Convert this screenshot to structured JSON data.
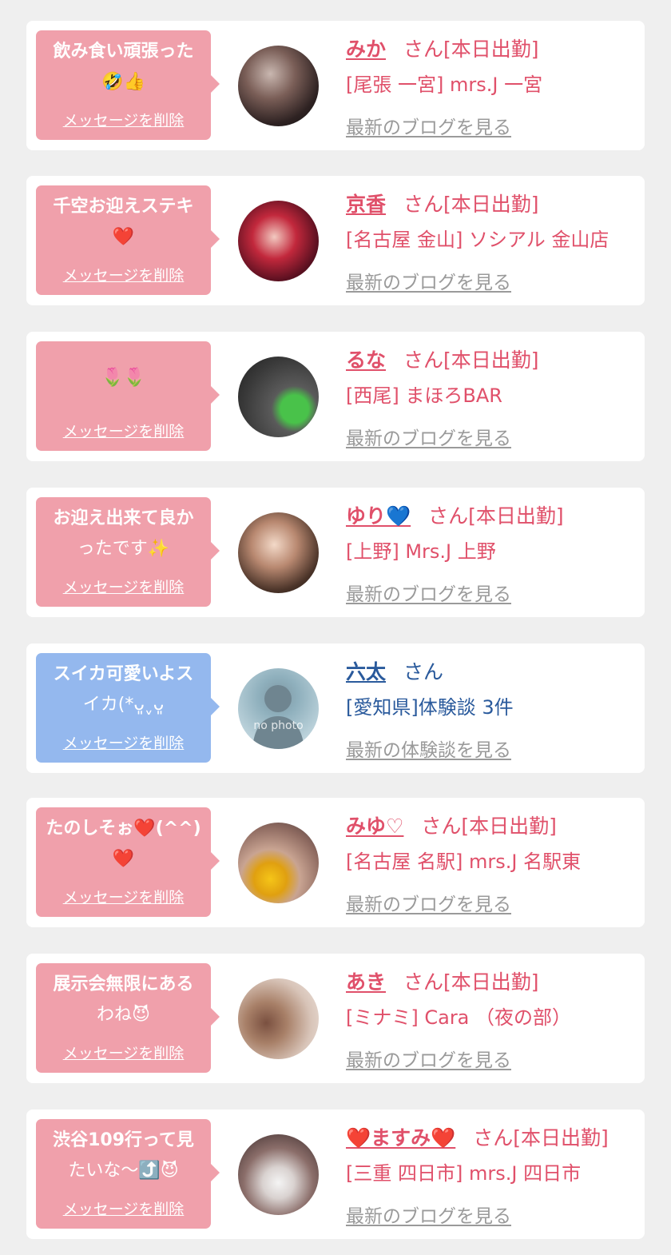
{
  "delete_label": "メッセージを削除",
  "colors": {
    "bubble_pink": "#f0a0ab",
    "bubble_blue": "#94b8ee",
    "cast_accent": "#e0506a",
    "user_accent": "#2a5a9c",
    "link_gray": "#9a9a9a"
  },
  "items": [
    {
      "type": "cast",
      "message_line1": "飲み食い頑張った",
      "message_line2": "🤣👍",
      "name": "みか",
      "suffix": "さん[本日出勤]",
      "shop": "[尾張 一宮] mrs.J 一宮",
      "link": "最新のブログを見る"
    },
    {
      "type": "cast",
      "message_line1": "千空お迎えステキ",
      "message_line2": "❤️",
      "name": "京香",
      "suffix": "さん[本日出勤]",
      "shop": "[名古屋 金山] ソシアル 金山店",
      "link": "最新のブログを見る"
    },
    {
      "type": "cast",
      "message_line1": "",
      "message_line2": "🌷🌷",
      "name": "るな",
      "suffix": "さん[本日出勤]",
      "shop": "[西尾] まほろBAR",
      "link": "最新のブログを見る"
    },
    {
      "type": "cast",
      "message_line1": "お迎え出来て良か",
      "message_line2": "ったです✨",
      "name": "ゆり💙",
      "suffix": "さん[本日出勤]",
      "shop": "[上野] Mrs.J 上野",
      "link": "最新のブログを見る"
    },
    {
      "type": "user",
      "message_line1": "スイカ可愛いよス",
      "message_line2": "イカ(*ᴗ͈ˬᴗ͈",
      "name": "六太",
      "suffix": "さん",
      "shop": "[愛知県]体験談 3件",
      "link": "最新の体験談を見る",
      "avatar_text": "no photo"
    },
    {
      "type": "cast",
      "message_line1": "たのしそぉ❤️(^^)",
      "message_line2": "❤️",
      "name": "みゆ♡",
      "suffix": "さん[本日出勤]",
      "shop": "[名古屋 名駅] mrs.J 名駅東",
      "link": "最新のブログを見る"
    },
    {
      "type": "cast",
      "message_line1": "展示会無限にある",
      "message_line2": "わね😈",
      "name": "あき",
      "suffix": "さん[本日出勤]",
      "shop": "[ミナミ] Cara （夜の部）",
      "link": "最新のブログを見る"
    },
    {
      "type": "cast",
      "message_line1": "渋谷109行って見",
      "message_line2": "たいな〜⤴️😈",
      "name": "❤️ますみ❤️",
      "suffix": "さん[本日出勤]",
      "shop": "[三重 四日市] mrs.J 四日市",
      "link": "最新のブログを見る"
    }
  ]
}
